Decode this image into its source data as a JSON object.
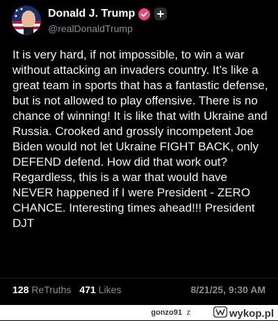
{
  "post": {
    "display_name": "Donald J. Trump",
    "handle": "@realDonaldTrump",
    "body": "It is very hard, if not impossible, to win a war without attacking an invaders country. It’s like a great team in sports that has a fantastic defense, but is not allowed to play offensive. There is no chance of winning! It is like that with Ukraine and Russia. Crooked and grossly incompetent Joe Biden would not let Ukraine FIGHT BACK, only DEFEND defend. How did that work out? Regardless, this is a war that would have NEVER happened if I were President - ZERO CHANCE. Interesting times ahead!!! President DJT",
    "retruths_count": "128",
    "retruths_label": "ReTruths",
    "likes_count": "471",
    "likes_label": "Likes",
    "timestamp": "8/21/25, 9:30 AM",
    "verified_icon": "verified-badge-icon",
    "plus_icon": "plus-icon"
  },
  "footer": {
    "username": "gonzo91",
    "separator": "z",
    "site_name": "wykop.pl",
    "logo_icon": "wykop-logo-icon"
  },
  "colors": {
    "background": "#000000",
    "text": "#ffffff",
    "muted": "#8b8b94",
    "verified": "#e8457a",
    "footer_bg": "#ffffff"
  }
}
